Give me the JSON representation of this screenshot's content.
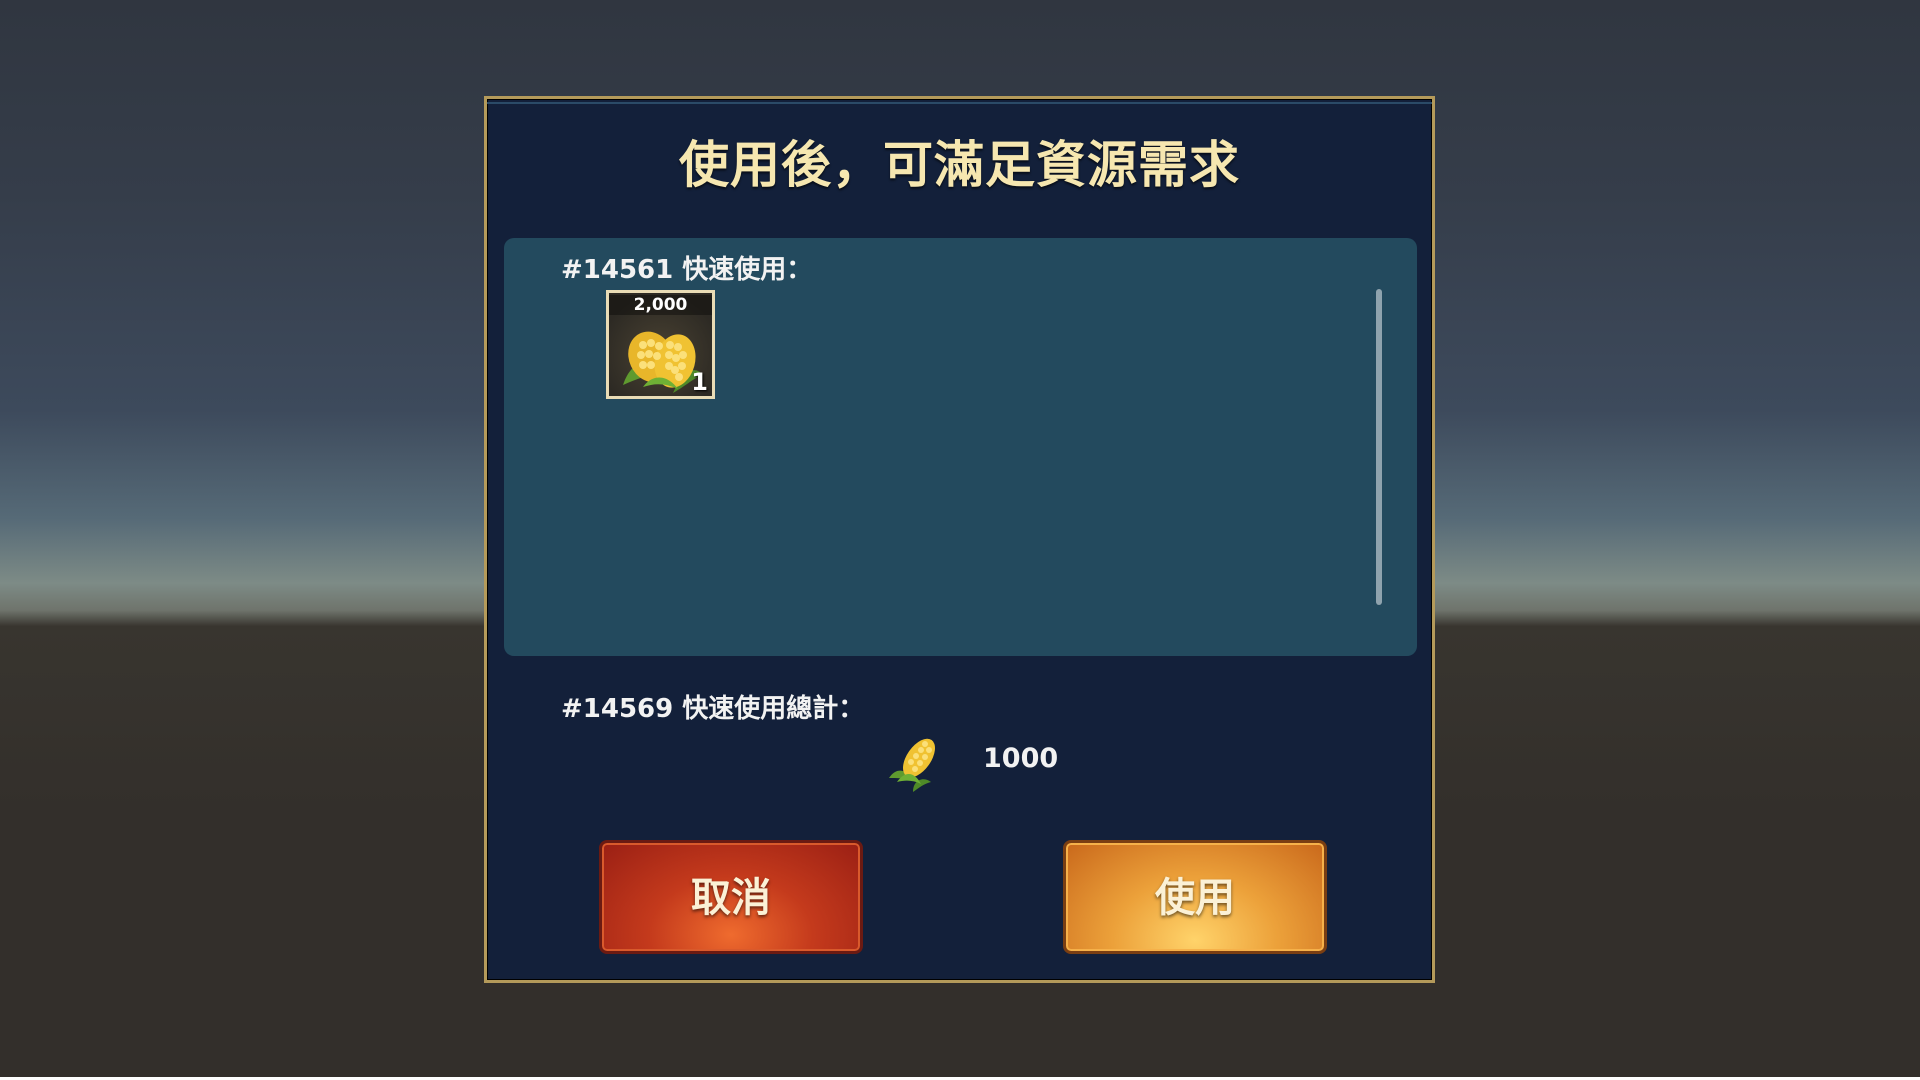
{
  "dialog": {
    "title": "使用後，可滿足資源需求"
  },
  "quick_use": {
    "label": "#14561 快速使用：",
    "items": [
      {
        "icon": "corn-icon",
        "amount": "2,000",
        "count": "1"
      }
    ]
  },
  "totals": {
    "label": "#14569 快速使用總計：",
    "icon": "corn-icon",
    "value": "1000"
  },
  "buttons": {
    "cancel_label": "取消",
    "use_label": "使用"
  },
  "colors": {
    "title": "#f6e7b0",
    "dialog_bg": "#13203a",
    "panel_bg": "#234a5e",
    "border_gold": "#b49a5a",
    "cancel_button": "#c43a1c",
    "use_button": "#eca13a"
  }
}
